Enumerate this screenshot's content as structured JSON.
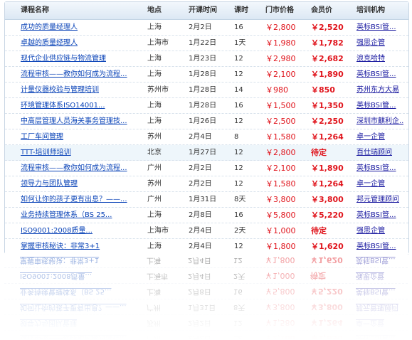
{
  "header": {
    "name": "课程名称",
    "location": "地点",
    "date": "开课时间",
    "days": "课时",
    "market_price": "门市价格",
    "member_price": "会员价",
    "org": "培训机构"
  },
  "rows": [
    {
      "name": "成功的质量经理人",
      "location": "上海",
      "date": "2月2日",
      "days": "16",
      "market_price": "￥2,800",
      "member_price": "￥2,520",
      "org": "英标BSI管..."
    },
    {
      "name": "卓越的质量经理人",
      "location": "上海市",
      "date": "1月22日",
      "days": "1天",
      "market_price": "￥1,980",
      "member_price": "￥1,782",
      "org": "强思企管"
    },
    {
      "name": "现代企业供应链与物流管理",
      "location": "上海",
      "date": "1月23日",
      "days": "12",
      "market_price": "￥2,980",
      "member_price": "￥2,682",
      "org": "浪克哈特"
    },
    {
      "name": "流程审核——教你如何成为流程...",
      "location": "上海",
      "date": "1月28日",
      "days": "12",
      "market_price": "￥2,100",
      "member_price": "￥1,890",
      "org": "英标BSI管..."
    },
    {
      "name": "计量仪器校验与管理培训",
      "location": "苏州市",
      "date": "1月28日",
      "days": "14",
      "market_price": "￥980",
      "member_price": "￥850",
      "org": "苏州东方大易"
    },
    {
      "name": "环境管理体系ISO14001...",
      "location": "上海",
      "date": "1月28日",
      "days": "16",
      "market_price": "￥1,500",
      "member_price": "￥1,350",
      "org": "英标BSI管..."
    },
    {
      "name": "中高层管理人员海关事务管理技...",
      "location": "上海",
      "date": "1月26日",
      "days": "12",
      "market_price": "￥2,500",
      "member_price": "￥2,250",
      "org": "深圳市麒利企..."
    },
    {
      "name": "工厂车间管理",
      "location": "苏州",
      "date": "2月4日",
      "days": "8",
      "market_price": "￥1,580",
      "member_price": "￥1,264",
      "org": "卓一企管"
    },
    {
      "name": "TTT-培训师培训",
      "location": "北京",
      "date": "1月27日",
      "days": "12",
      "market_price": "￥2,800",
      "member_price": "待定",
      "org": "百仕瑞顾问"
    },
    {
      "name": "流程审核——教你如何成为流程...",
      "location": "广州",
      "date": "2月2日",
      "days": "12",
      "market_price": "￥2,100",
      "member_price": "￥1,890",
      "org": "英标BSI管..."
    },
    {
      "name": "领导力与团队管理",
      "location": "苏州",
      "date": "2月2日",
      "days": "12",
      "market_price": "￥1,580",
      "member_price": "￥1,264",
      "org": "卓一企管"
    },
    {
      "name": "如何让你的孩子更有出息？——...",
      "location": "广州",
      "date": "1月31日",
      "days": "8天",
      "market_price": "￥3,800",
      "member_price": "￥3,800",
      "org": "邦元管理顾问"
    },
    {
      "name": "业务持续管理体系（BS 25...",
      "location": "上海",
      "date": "2月8日",
      "days": "16",
      "market_price": "￥5,800",
      "member_price": "￥5,220",
      "org": "英标BSI管..."
    },
    {
      "name": "ISO9001:2008质量...",
      "location": "上海市",
      "date": "2月4日",
      "days": "2天",
      "market_price": "￥1,000",
      "member_price": "待定",
      "org": "强思企管"
    },
    {
      "name": "掌握审核秘诀：非常3+1",
      "location": "上海",
      "date": "2月4日",
      "days": "12",
      "market_price": "￥1,800",
      "member_price": "￥1,620",
      "org": "英标BSI管..."
    }
  ],
  "highlight_row": 8,
  "colors": {
    "link": "#0b44b8",
    "price": "#e0141c",
    "org": "#1a1aa0",
    "header_bg": "#dce8f4"
  }
}
